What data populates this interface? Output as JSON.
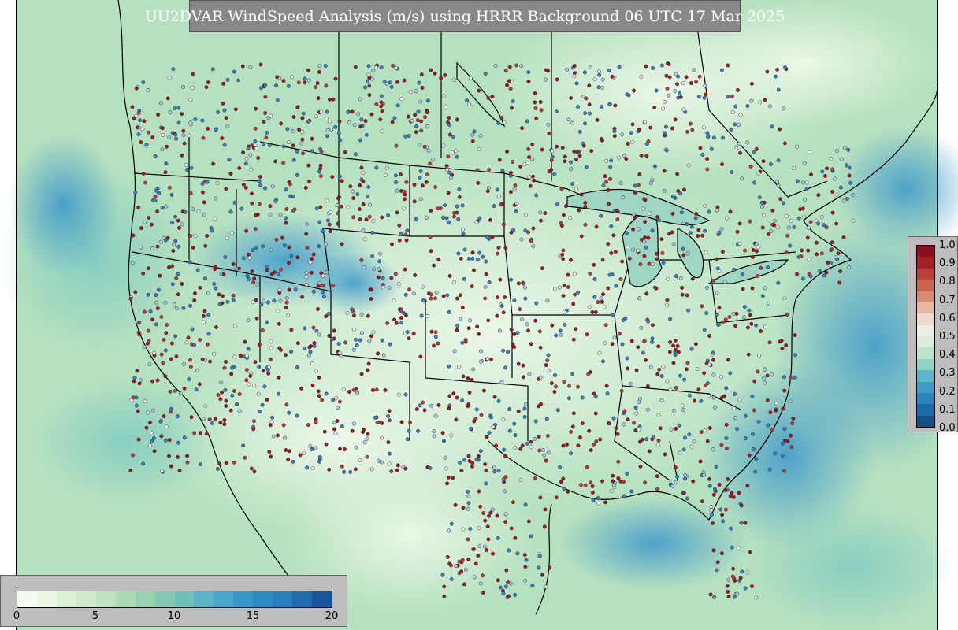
{
  "title": "UU2DVAR WindSpeed Analysis (m/s) using HRRR Background 06 UTC 17 Mar 2025",
  "colorbar_obs": {
    "ticks": [
      "0.0",
      "0.1",
      "0.2",
      "0.3",
      "0.4",
      "0.5",
      "0.6",
      "0.7",
      "0.8",
      "0.9",
      "1.0"
    ],
    "colors": [
      "#8b0e1e",
      "#a3202a",
      "#b8413a",
      "#c96450",
      "#d88c74",
      "#e8b8a4",
      "#efd9cd",
      "#eeeee8",
      "#dcecdc",
      "#bde2cf",
      "#91d2c2",
      "#5eb6cd",
      "#3c9cc6",
      "#2a84bc",
      "#1d6aa6",
      "#154f86"
    ]
  },
  "colorbar_wind": {
    "ticks": [
      "0",
      "5",
      "10",
      "15",
      "20"
    ],
    "colors": [
      "#f3fbef",
      "#e8f6e3",
      "#dcf1d6",
      "#cdebca",
      "#bde4bf",
      "#acdcb6",
      "#98d2b0",
      "#84c8b4",
      "#6fbfbd",
      "#5bb3c8",
      "#49a6cb",
      "#3a98c8",
      "#2e8bc2",
      "#2a7ebb",
      "#1f6dac",
      "#17559a"
    ]
  },
  "map": {
    "background_colors": [
      "#cdebcd",
      "#a8dcba",
      "#7ccbc0",
      "#49a3cc",
      "#e6f4e2"
    ],
    "obs_colors": [
      "#9a1b26",
      "#b63a3a",
      "#3a7fbf",
      "#aecce6",
      "#f2f2f2"
    ]
  }
}
